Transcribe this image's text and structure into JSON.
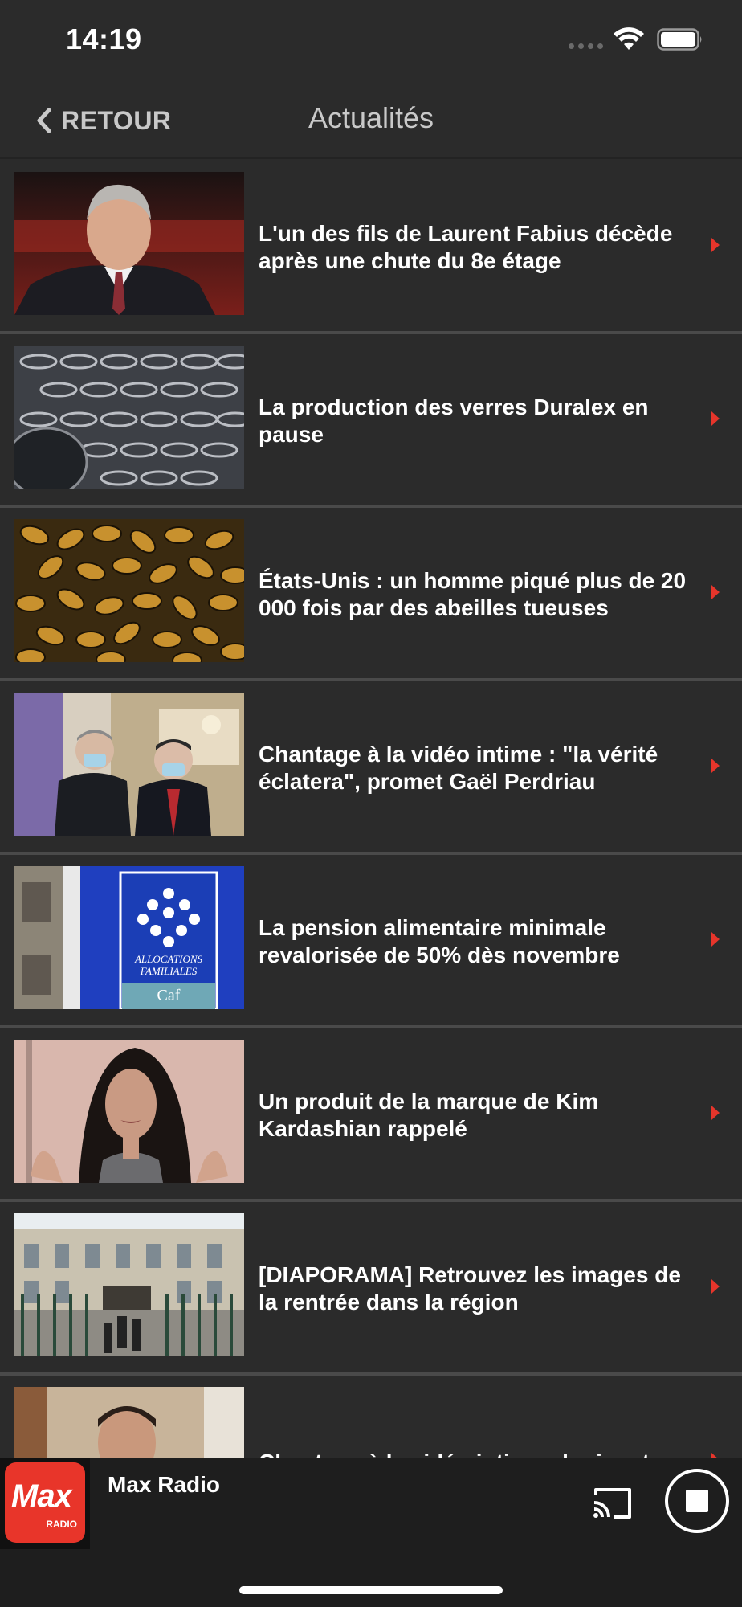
{
  "status_bar": {
    "time": "14:19"
  },
  "nav": {
    "back_label": "RETOUR",
    "title": "Actualités"
  },
  "news": [
    {
      "title": "L'un des fils de Laurent Fabius décède après une chute du 8e étage",
      "thumb": "portrait-man-suit"
    },
    {
      "title": "La production des verres Duralex en pause",
      "thumb": "glasses-rows"
    },
    {
      "title": "États-Unis : un homme piqué plus de 20 000 fois par des abeilles tueuses",
      "thumb": "bees-swarm"
    },
    {
      "title": "Chantage à la vidéo intime : \"la vérité éclatera\", promet Gaël Perdriau",
      "thumb": "two-men-masks"
    },
    {
      "title": "La pension alimentaire minimale revalorisée de 50% dès novembre",
      "thumb": "caf-sign"
    },
    {
      "title": "Un produit de la marque de Kim Kardashian rappelé",
      "thumb": "woman-portrait"
    },
    {
      "title": "[DIAPORAMA] Retrouvez les images de la rentrée dans la région",
      "thumb": "school-building"
    },
    {
      "title": "Chantage à la vidéo intime : la riposte",
      "thumb": "man-portrait"
    }
  ],
  "thumb_text": {
    "caf_line1": "ALLOCATIONS",
    "caf_line2": "FAMILIALES",
    "caf_brand": "Caf"
  },
  "player": {
    "station_name": "Max Radio",
    "logo_word": "Max",
    "logo_sub": "RADIO"
  },
  "colors": {
    "accent": "#e6352b",
    "background": "#2b2b2b",
    "separator": "#4a4a4a"
  }
}
